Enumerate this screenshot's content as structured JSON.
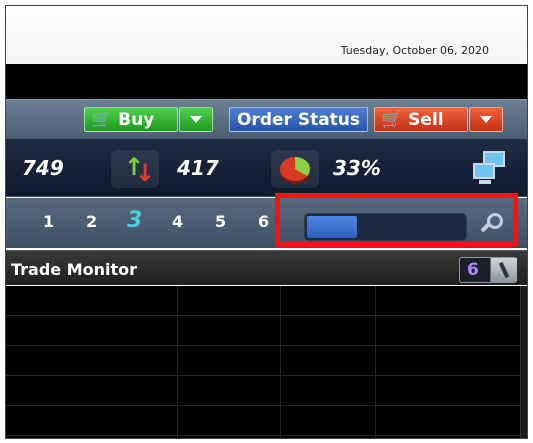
{
  "header": {
    "date": "Tuesday, October 06, 2020"
  },
  "toolbar": {
    "buy_label": "Buy",
    "order_status_label": "Order Status",
    "sell_label": "Sell",
    "colors": {
      "buy": "#2bb22a",
      "order_status": "#3366c4",
      "sell": "#d8421f"
    }
  },
  "stats": {
    "value_1": "749",
    "value_2": "417",
    "value_3": "33%"
  },
  "pages": {
    "items": [
      "1",
      "2",
      "3",
      "4",
      "5",
      "6"
    ],
    "active": "3",
    "search_progress": 0.31
  },
  "trade_monitor": {
    "title": "Trade Monitor",
    "badge_count": "6"
  },
  "icons": [
    "cart-icon",
    "chevron-down-icon",
    "up-down-arrows-icon",
    "pie-chart-icon",
    "network-computers-icon",
    "magnifier-icon",
    "wrench-icon"
  ]
}
